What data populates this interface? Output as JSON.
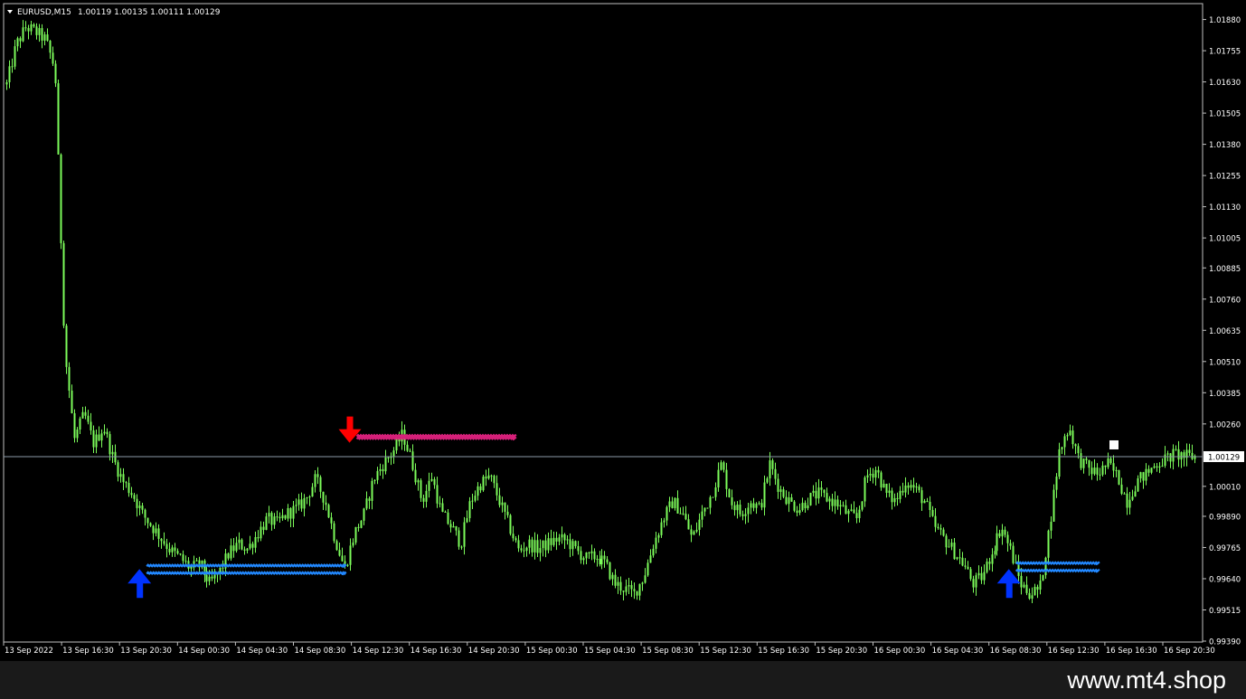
{
  "header": {
    "symbol": "EURUSD,M15",
    "ohlc": "1.00119 1.00135 1.00111 1.00129"
  },
  "watermark": "www.mt4.shop",
  "colors": {
    "background": "#000000",
    "frame": "#c0c0c0",
    "candle": "#7cfc5a",
    "bid_line": "#8c9aa8",
    "sell_arrow": "#ff0000",
    "sell_lines": "#d8207a",
    "buy_arrow": "#0033ff",
    "buy_lines": "#2288ff"
  },
  "chart_data": {
    "type": "candlestick",
    "symbol": "EURUSD",
    "timeframe": "M15",
    "ylim": [
      0.9939,
      1.0194
    ],
    "y_ticks": [
      "1.01880",
      "1.01755",
      "1.01630",
      "1.01505",
      "1.01380",
      "1.01255",
      "1.01130",
      "1.01005",
      "1.00885",
      "1.00760",
      "1.00635",
      "1.00510",
      "1.00385",
      "1.00260",
      "1.00129",
      "1.00010",
      "0.99890",
      "0.99765",
      "0.99640",
      "0.99515",
      "0.99390"
    ],
    "x_ticks": [
      "13 Sep 2022",
      "13 Sep 16:30",
      "13 Sep 20:30",
      "14 Sep 00:30",
      "14 Sep 04:30",
      "14 Sep 08:30",
      "14 Sep 12:30",
      "14 Sep 16:30",
      "14 Sep 20:30",
      "15 Sep 00:30",
      "15 Sep 04:30",
      "15 Sep 08:30",
      "15 Sep 12:30",
      "15 Sep 16:30",
      "15 Sep 20:30",
      "16 Sep 00:30",
      "16 Sep 04:30",
      "16 Sep 08:30",
      "16 Sep 12:30",
      "16 Sep 16:30",
      "16 Sep 20:30"
    ],
    "current_price": 1.00129,
    "current_price_label": "1.00129",
    "close_path": [
      [
        0,
        1.0162
      ],
      [
        1,
        1.0178
      ],
      [
        2,
        1.0185
      ],
      [
        3,
        1.0183
      ],
      [
        4,
        1.018
      ],
      [
        5,
        1.0168
      ],
      [
        6,
        1.0055
      ],
      [
        7,
        1.002
      ],
      [
        8,
        1.003
      ],
      [
        9,
        1.0018
      ],
      [
        10,
        1.0025
      ],
      [
        11,
        1.0012
      ],
      [
        12,
        1.0003
      ],
      [
        13,
        0.9998
      ],
      [
        14,
        0.999
      ],
      [
        15,
        0.9985
      ],
      [
        16,
        0.998
      ],
      [
        17,
        0.9975
      ],
      [
        18,
        0.9972
      ],
      [
        19,
        0.9968
      ],
      [
        20,
        0.997
      ],
      [
        21,
        0.9962
      ],
      [
        22,
        0.9966
      ],
      [
        23,
        0.9974
      ],
      [
        24,
        0.9978
      ],
      [
        25,
        0.9976
      ],
      [
        26,
        0.9982
      ],
      [
        27,
        0.9988
      ],
      [
        28,
        0.9986
      ],
      [
        29,
        0.999
      ],
      [
        30,
        0.9992
      ],
      [
        31,
        0.9996
      ],
      [
        32,
        1.0004
      ],
      [
        33,
        0.9995
      ],
      [
        34,
        0.998
      ],
      [
        35,
        0.9968
      ],
      [
        36,
        0.9982
      ],
      [
        37,
        0.999
      ],
      [
        38,
        1.0004
      ],
      [
        39,
        1.001
      ],
      [
        40,
        1.0015
      ],
      [
        41,
        1.0022
      ],
      [
        42,
        1.001
      ],
      [
        43,
        0.9995
      ],
      [
        44,
        1.0005
      ],
      [
        45,
        0.999
      ],
      [
        46,
        0.9985
      ],
      [
        47,
        0.9978
      ],
      [
        48,
        0.9995
      ],
      [
        49,
        1.0002
      ],
      [
        50,
        1.0005
      ],
      [
        51,
        0.9995
      ],
      [
        52,
        0.9985
      ],
      [
        53,
        0.9975
      ],
      [
        54,
        0.9978
      ],
      [
        55,
        0.9976
      ],
      [
        56,
        0.9978
      ],
      [
        57,
        0.998
      ],
      [
        58,
        0.9979
      ],
      [
        59,
        0.9975
      ],
      [
        60,
        0.9972
      ],
      [
        61,
        0.9973
      ],
      [
        62,
        0.997
      ],
      [
        63,
        0.9962
      ],
      [
        64,
        0.996
      ],
      [
        65,
        0.9958
      ],
      [
        66,
        0.9965
      ],
      [
        67,
        0.9978
      ],
      [
        68,
        0.9988
      ],
      [
        69,
        0.9995
      ],
      [
        70,
        0.999
      ],
      [
        71,
        0.998
      ],
      [
        72,
        0.999
      ],
      [
        73,
        0.9998
      ],
      [
        74,
        1.001
      ],
      [
        75,
        0.9995
      ],
      [
        76,
        0.999
      ],
      [
        77,
        0.9995
      ],
      [
        78,
        0.9992
      ],
      [
        79,
        1.001
      ],
      [
        80,
        1.0
      ],
      [
        81,
        0.9995
      ],
      [
        82,
        0.9992
      ],
      [
        83,
        0.9996
      ],
      [
        84,
        0.9998
      ],
      [
        85,
        0.9996
      ],
      [
        86,
        0.9994
      ],
      [
        87,
        0.999
      ],
      [
        88,
        0.9988
      ],
      [
        89,
        1.0005
      ],
      [
        90,
        1.0008
      ],
      [
        91,
        0.9998
      ],
      [
        92,
        0.9995
      ],
      [
        93,
        1.0003
      ],
      [
        94,
        1.0
      ],
      [
        95,
        0.9995
      ],
      [
        96,
        0.9985
      ],
      [
        97,
        0.998
      ],
      [
        98,
        0.9975
      ],
      [
        99,
        0.997
      ],
      [
        100,
        0.9962
      ],
      [
        101,
        0.9965
      ],
      [
        102,
        0.9975
      ],
      [
        103,
        0.9985
      ],
      [
        104,
        0.9975
      ],
      [
        105,
        0.9962
      ],
      [
        106,
        0.9958
      ],
      [
        107,
        0.996
      ],
      [
        108,
        0.9985
      ],
      [
        109,
        1.0015
      ],
      [
        110,
        1.0025
      ],
      [
        111,
        1.0012
      ],
      [
        112,
        1.0008
      ],
      [
        113,
        1.0006
      ],
      [
        114,
        1.001
      ],
      [
        115,
        1.0005
      ],
      [
        116,
        0.9995
      ],
      [
        117,
        1.0003
      ],
      [
        118,
        1.0006
      ],
      [
        119,
        1.001
      ],
      [
        120,
        1.0012
      ],
      [
        121,
        1.0014
      ],
      [
        122,
        1.0013
      ],
      [
        123,
        1.0013
      ]
    ],
    "signals": [
      {
        "type": "sell",
        "label_price": 1.0021,
        "from_x": "14 Sep 08:30",
        "to_x": "14 Sep 20:30",
        "lines": [
          1.0021,
          1.002
        ]
      },
      {
        "type": "buy",
        "label_price": 0.9965,
        "from_x": "13 Sep 20:30",
        "to_x": "14 Sep 12:30",
        "lines": [
          0.9969,
          0.9966
        ]
      },
      {
        "type": "buy",
        "label_price": 0.9965,
        "from_x": "16 Sep 08:30",
        "to_x": "16 Sep 16:30",
        "lines": [
          0.997,
          0.9967
        ]
      }
    ]
  }
}
